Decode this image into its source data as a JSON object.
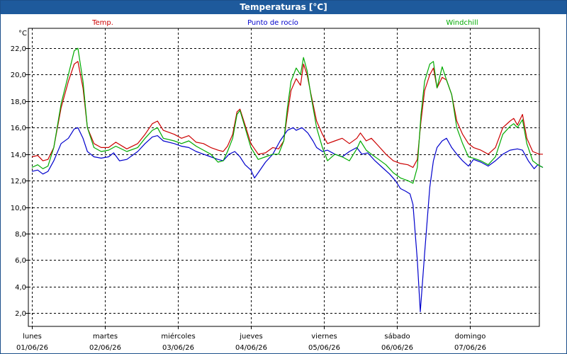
{
  "window": {
    "title": "Temperaturas [°C]"
  },
  "chart_data": {
    "type": "line",
    "title": "Temperaturas [°C]",
    "ylabel": "°C",
    "ylim": [
      1.0,
      23.5
    ],
    "yticks": [
      2.0,
      4.0,
      6.0,
      8.0,
      10.0,
      12.0,
      14.0,
      16.0,
      18.0,
      20.0,
      22.0
    ],
    "ytick_labels": [
      "2,0",
      "4,0",
      "6,0",
      "8,0",
      "10,0",
      "12,0",
      "14,0",
      "16,0",
      "18,0",
      "20,0",
      "22,0"
    ],
    "xlim": [
      0,
      7.0
    ],
    "x_ticks": [
      {
        "x": 0,
        "day": "lunes",
        "date": "01/06/26"
      },
      {
        "x": 1,
        "day": "martes",
        "date": "02/06/26"
      },
      {
        "x": 2,
        "day": "miércoles",
        "date": "03/06/26"
      },
      {
        "x": 3,
        "day": "jueves",
        "date": "04/06/26"
      },
      {
        "x": 4,
        "day": "viernes",
        "date": "05/06/26"
      },
      {
        "x": 5,
        "day": "sábado",
        "date": "06/06/26"
      },
      {
        "x": 6,
        "day": "domingo",
        "date": "07/06/26"
      }
    ],
    "grid": true,
    "legend": "top",
    "series": [
      {
        "name": "Temp.",
        "color": "#cc0000",
        "points": [
          [
            0.0,
            13.8
          ],
          [
            0.08,
            13.9
          ],
          [
            0.15,
            13.5
          ],
          [
            0.22,
            13.6
          ],
          [
            0.3,
            14.5
          ],
          [
            0.4,
            17.5
          ],
          [
            0.5,
            19.5
          ],
          [
            0.58,
            20.8
          ],
          [
            0.63,
            21.0
          ],
          [
            0.7,
            19.0
          ],
          [
            0.76,
            16.0
          ],
          [
            0.85,
            14.8
          ],
          [
            0.95,
            14.5
          ],
          [
            1.05,
            14.5
          ],
          [
            1.15,
            14.9
          ],
          [
            1.3,
            14.4
          ],
          [
            1.45,
            14.8
          ],
          [
            1.55,
            15.5
          ],
          [
            1.65,
            16.3
          ],
          [
            1.72,
            16.5
          ],
          [
            1.8,
            15.8
          ],
          [
            1.95,
            15.5
          ],
          [
            2.05,
            15.2
          ],
          [
            2.15,
            15.4
          ],
          [
            2.25,
            14.9
          ],
          [
            2.35,
            14.8
          ],
          [
            2.45,
            14.5
          ],
          [
            2.55,
            14.3
          ],
          [
            2.62,
            14.2
          ],
          [
            2.68,
            14.6
          ],
          [
            2.75,
            15.5
          ],
          [
            2.81,
            17.2
          ],
          [
            2.85,
            17.4
          ],
          [
            2.92,
            16.2
          ],
          [
            3.0,
            14.8
          ],
          [
            3.1,
            14.0
          ],
          [
            3.2,
            14.1
          ],
          [
            3.3,
            14.5
          ],
          [
            3.38,
            14.4
          ],
          [
            3.45,
            15.0
          ],
          [
            3.5,
            17.0
          ],
          [
            3.55,
            18.8
          ],
          [
            3.62,
            19.7
          ],
          [
            3.68,
            19.2
          ],
          [
            3.72,
            20.8
          ],
          [
            3.77,
            20.0
          ],
          [
            3.82,
            18.6
          ],
          [
            3.9,
            16.5
          ],
          [
            3.98,
            15.5
          ],
          [
            4.05,
            14.8
          ],
          [
            4.15,
            15.0
          ],
          [
            4.25,
            15.2
          ],
          [
            4.35,
            14.8
          ],
          [
            4.45,
            15.2
          ],
          [
            4.5,
            15.6
          ],
          [
            4.58,
            15.0
          ],
          [
            4.65,
            15.2
          ],
          [
            4.75,
            14.6
          ],
          [
            4.85,
            14.0
          ],
          [
            4.95,
            13.5
          ],
          [
            5.05,
            13.3
          ],
          [
            5.15,
            13.2
          ],
          [
            5.22,
            13.0
          ],
          [
            5.28,
            13.6
          ],
          [
            5.33,
            16.5
          ],
          [
            5.38,
            18.8
          ],
          [
            5.45,
            20.0
          ],
          [
            5.5,
            20.5
          ],
          [
            5.55,
            19.0
          ],
          [
            5.62,
            19.8
          ],
          [
            5.68,
            19.6
          ],
          [
            5.75,
            18.5
          ],
          [
            5.82,
            16.5
          ],
          [
            5.9,
            15.5
          ],
          [
            5.98,
            14.8
          ],
          [
            6.05,
            14.5
          ],
          [
            6.15,
            14.3
          ],
          [
            6.25,
            14.0
          ],
          [
            6.35,
            14.5
          ],
          [
            6.45,
            16.0
          ],
          [
            6.55,
            16.5
          ],
          [
            6.6,
            16.7
          ],
          [
            6.65,
            16.2
          ],
          [
            6.72,
            17.0
          ],
          [
            6.78,
            15.2
          ],
          [
            6.86,
            14.2
          ],
          [
            6.95,
            14.0
          ],
          [
            7.0,
            14.0
          ]
        ]
      },
      {
        "name": "Punto de rocío",
        "color": "#0000cc",
        "points": [
          [
            0.0,
            12.7
          ],
          [
            0.08,
            12.8
          ],
          [
            0.15,
            12.5
          ],
          [
            0.22,
            12.7
          ],
          [
            0.3,
            13.5
          ],
          [
            0.4,
            14.8
          ],
          [
            0.5,
            15.2
          ],
          [
            0.58,
            15.9
          ],
          [
            0.63,
            16.0
          ],
          [
            0.7,
            15.2
          ],
          [
            0.76,
            14.2
          ],
          [
            0.85,
            13.8
          ],
          [
            0.95,
            13.7
          ],
          [
            1.05,
            13.8
          ],
          [
            1.12,
            14.1
          ],
          [
            1.2,
            13.5
          ],
          [
            1.3,
            13.6
          ],
          [
            1.45,
            14.2
          ],
          [
            1.55,
            14.8
          ],
          [
            1.65,
            15.3
          ],
          [
            1.72,
            15.4
          ],
          [
            1.8,
            15.0
          ],
          [
            1.95,
            14.8
          ],
          [
            2.05,
            14.6
          ],
          [
            2.15,
            14.5
          ],
          [
            2.25,
            14.2
          ],
          [
            2.35,
            14.0
          ],
          [
            2.45,
            13.8
          ],
          [
            2.55,
            13.6
          ],
          [
            2.62,
            13.5
          ],
          [
            2.7,
            14.0
          ],
          [
            2.78,
            14.2
          ],
          [
            2.85,
            13.8
          ],
          [
            2.92,
            13.2
          ],
          [
            3.0,
            12.8
          ],
          [
            3.05,
            12.2
          ],
          [
            3.1,
            12.6
          ],
          [
            3.2,
            13.4
          ],
          [
            3.3,
            14.0
          ],
          [
            3.4,
            15.0
          ],
          [
            3.5,
            15.8
          ],
          [
            3.58,
            16.0
          ],
          [
            3.62,
            15.8
          ],
          [
            3.7,
            16.0
          ],
          [
            3.78,
            15.6
          ],
          [
            3.85,
            15.0
          ],
          [
            3.9,
            14.5
          ],
          [
            3.98,
            14.2
          ],
          [
            4.05,
            14.3
          ],
          [
            4.15,
            14.0
          ],
          [
            4.25,
            13.8
          ],
          [
            4.35,
            14.2
          ],
          [
            4.45,
            14.5
          ],
          [
            4.52,
            14.0
          ],
          [
            4.6,
            14.1
          ],
          [
            4.7,
            13.5
          ],
          [
            4.8,
            13.0
          ],
          [
            4.9,
            12.5
          ],
          [
            4.98,
            12.0
          ],
          [
            5.05,
            11.4
          ],
          [
            5.12,
            11.2
          ],
          [
            5.18,
            11.0
          ],
          [
            5.22,
            10.2
          ],
          [
            5.28,
            6.0
          ],
          [
            5.32,
            2.1
          ],
          [
            5.38,
            6.5
          ],
          [
            5.45,
            11.5
          ],
          [
            5.5,
            13.5
          ],
          [
            5.55,
            14.5
          ],
          [
            5.62,
            15.0
          ],
          [
            5.68,
            15.2
          ],
          [
            5.75,
            14.5
          ],
          [
            5.82,
            14.0
          ],
          [
            5.9,
            13.5
          ],
          [
            5.98,
            13.1
          ],
          [
            6.05,
            13.6
          ],
          [
            6.15,
            13.4
          ],
          [
            6.25,
            13.1
          ],
          [
            6.35,
            13.5
          ],
          [
            6.45,
            14.0
          ],
          [
            6.55,
            14.3
          ],
          [
            6.65,
            14.4
          ],
          [
            6.72,
            14.3
          ],
          [
            6.8,
            13.5
          ],
          [
            6.88,
            12.9
          ],
          [
            6.93,
            13.2
          ],
          [
            7.0,
            13.0
          ]
        ]
      },
      {
        "name": "Windchill",
        "color": "#00aa00",
        "points": [
          [
            0.0,
            13.0
          ],
          [
            0.08,
            13.2
          ],
          [
            0.15,
            12.9
          ],
          [
            0.22,
            13.1
          ],
          [
            0.3,
            14.5
          ],
          [
            0.4,
            17.8
          ],
          [
            0.5,
            20.0
          ],
          [
            0.58,
            21.8
          ],
          [
            0.63,
            22.0
          ],
          [
            0.7,
            19.5
          ],
          [
            0.76,
            16.0
          ],
          [
            0.85,
            14.5
          ],
          [
            0.95,
            14.2
          ],
          [
            1.05,
            14.3
          ],
          [
            1.15,
            14.6
          ],
          [
            1.3,
            14.2
          ],
          [
            1.45,
            14.5
          ],
          [
            1.55,
            15.2
          ],
          [
            1.65,
            15.8
          ],
          [
            1.72,
            16.0
          ],
          [
            1.8,
            15.2
          ],
          [
            1.95,
            15.0
          ],
          [
            2.05,
            14.8
          ],
          [
            2.15,
            15.0
          ],
          [
            2.25,
            14.6
          ],
          [
            2.35,
            14.3
          ],
          [
            2.45,
            14.0
          ],
          [
            2.55,
            13.4
          ],
          [
            2.62,
            13.5
          ],
          [
            2.68,
            14.2
          ],
          [
            2.75,
            15.2
          ],
          [
            2.81,
            17.0
          ],
          [
            2.85,
            17.3
          ],
          [
            2.92,
            16.0
          ],
          [
            3.0,
            14.5
          ],
          [
            3.1,
            13.6
          ],
          [
            3.2,
            13.8
          ],
          [
            3.3,
            14.0
          ],
          [
            3.38,
            14.0
          ],
          [
            3.45,
            15.0
          ],
          [
            3.5,
            17.5
          ],
          [
            3.55,
            19.5
          ],
          [
            3.62,
            20.5
          ],
          [
            3.68,
            20.0
          ],
          [
            3.72,
            21.3
          ],
          [
            3.77,
            20.3
          ],
          [
            3.82,
            18.5
          ],
          [
            3.9,
            16.0
          ],
          [
            3.98,
            14.5
          ],
          [
            4.05,
            13.5
          ],
          [
            4.15,
            14.0
          ],
          [
            4.25,
            13.8
          ],
          [
            4.35,
            13.5
          ],
          [
            4.45,
            14.4
          ],
          [
            4.5,
            15.0
          ],
          [
            4.58,
            14.3
          ],
          [
            4.65,
            14.0
          ],
          [
            4.75,
            13.6
          ],
          [
            4.85,
            13.2
          ],
          [
            4.95,
            12.6
          ],
          [
            5.05,
            12.2
          ],
          [
            5.15,
            12.0
          ],
          [
            5.22,
            11.8
          ],
          [
            5.28,
            13.0
          ],
          [
            5.33,
            17.0
          ],
          [
            5.38,
            19.5
          ],
          [
            5.45,
            20.8
          ],
          [
            5.5,
            21.0
          ],
          [
            5.55,
            19.0
          ],
          [
            5.62,
            20.6
          ],
          [
            5.68,
            19.6
          ],
          [
            5.75,
            18.5
          ],
          [
            5.82,
            16.0
          ],
          [
            5.9,
            14.8
          ],
          [
            5.98,
            13.8
          ],
          [
            6.05,
            13.7
          ],
          [
            6.15,
            13.5
          ],
          [
            6.25,
            13.2
          ],
          [
            6.35,
            13.8
          ],
          [
            6.45,
            15.5
          ],
          [
            6.55,
            16.1
          ],
          [
            6.6,
            16.3
          ],
          [
            6.65,
            16.0
          ],
          [
            6.72,
            16.6
          ],
          [
            6.78,
            14.8
          ],
          [
            6.86,
            13.5
          ],
          [
            6.93,
            13.2
          ],
          [
            7.0,
            13.0
          ]
        ]
      }
    ]
  }
}
